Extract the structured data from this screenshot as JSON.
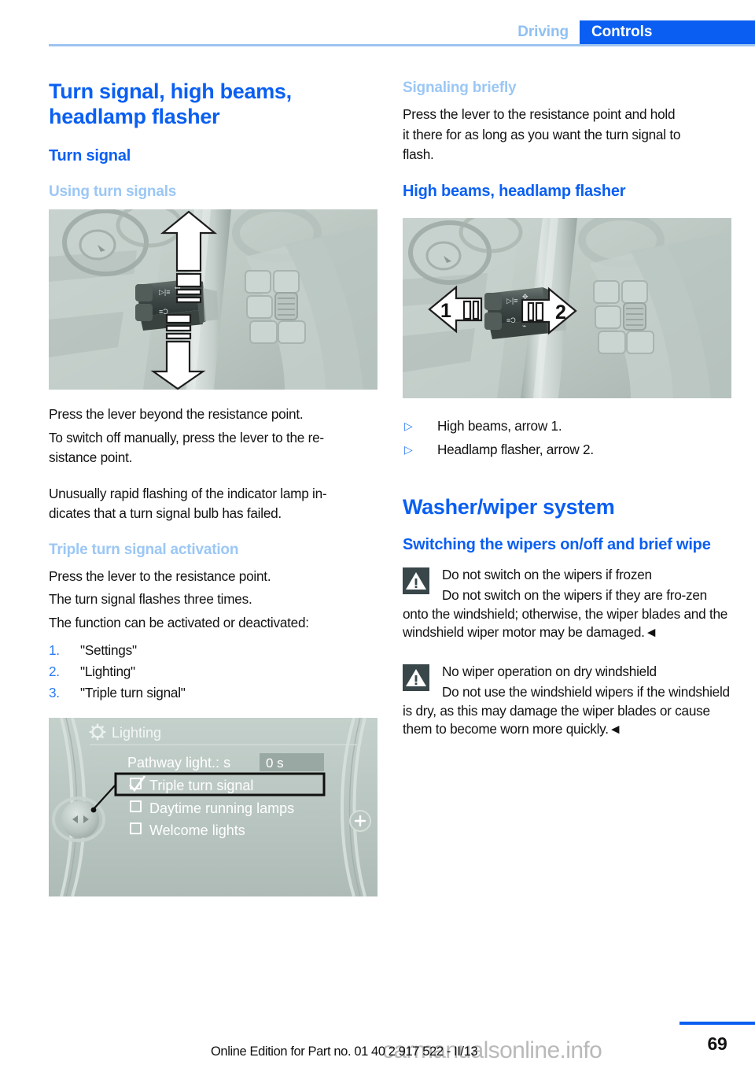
{
  "header": {
    "breadcrumb_inactive": "Driving",
    "breadcrumb_active": "Controls",
    "accent_blue": "#0a5ff2",
    "light_blue": "#9bc7f5"
  },
  "left_column": {
    "section_title": "Turn signal, high beams, headlamp flasher",
    "subsection_title": "Turn signal",
    "topic_title": "Using turn signals",
    "photo_alt": "Steering column turn signal lever with up and down arrows",
    "paragraphs": [
      "Press the lever beyond the resistance point.",
      "To switch off manually, press the lever to the re-sistance point.",
      "Unusually rapid flashing of the indicator lamp in-dicates that a turn signal bulb has failed."
    ],
    "para_1": "Press the lever beyond the resistance point.",
    "para_2": "To switch off manually, press the lever to the re-",
    "para_2b": "sistance point.",
    "para_3": "Unusually rapid flashing of the indicator lamp in-",
    "para_3b": "dicates that a turn signal bulb has failed.",
    "triple": {
      "title": "Triple turn signal activation",
      "line_1": "Press the lever to the resistance point.",
      "line_2": "The turn signal flashes three times.",
      "line_3": "The function can be activated or deactivated:",
      "steps": [
        {
          "num": "1.",
          "label": "\"Settings\""
        },
        {
          "num": "2.",
          "label": "\"Lighting\""
        },
        {
          "num": "3.",
          "label": "\"Triple turn signal\""
        }
      ]
    },
    "idrive": {
      "menu_title": "Lighting",
      "gear_icon": "gear-icon",
      "rows": [
        {
          "label": "Pathway light.: s",
          "value": "0 s",
          "type": "value"
        },
        {
          "label": "Triple turn signal",
          "checked": true,
          "type": "checkbox",
          "highlighted": true
        },
        {
          "label": "Daytime running lamps",
          "checked": false,
          "type": "checkbox"
        },
        {
          "label": "Welcome lights",
          "checked": false,
          "type": "checkbox"
        }
      ]
    }
  },
  "right_column": {
    "signaling": {
      "title": "Signaling briefly",
      "line_1": "Press the lever to the resistance point and hold",
      "line_2": "it there for as long as you want the turn signal to",
      "line_3": "flash."
    },
    "high_beams": {
      "title": "High beams, headlamp flasher",
      "photo_alt": "Steering column lever with left arrow 1 and right arrow 2",
      "arrow_1_label": "1",
      "arrow_2_label": "2",
      "bullets": [
        "High beams, arrow 1.",
        "Headlamp flasher, arrow 2."
      ]
    },
    "washer": {
      "section_title": "Washer/wiper system",
      "sub_title": "Switching the wipers on/off and brief wipe",
      "warnings": [
        {
          "icon": "warning-triangle-icon",
          "title": "Do not switch on the wipers if frozen",
          "body": "Do not switch on the wipers if they are fro-zen onto the windshield; otherwise, the wiper blades and the windshield wiper motor may be damaged.◄"
        },
        {
          "icon": "warning-triangle-icon",
          "title": "No wiper operation on dry windshield",
          "body": "Do not use the windshield wipers if the windshield is dry, as this may damage the wiper blades or cause them to become worn more quickly.◄"
        }
      ]
    }
  },
  "footer": {
    "edition_note": "Online Edition for Part no. 01 40 2 917 522 - II/13",
    "watermark": "carmanualsonline.info",
    "page_number": "69"
  }
}
